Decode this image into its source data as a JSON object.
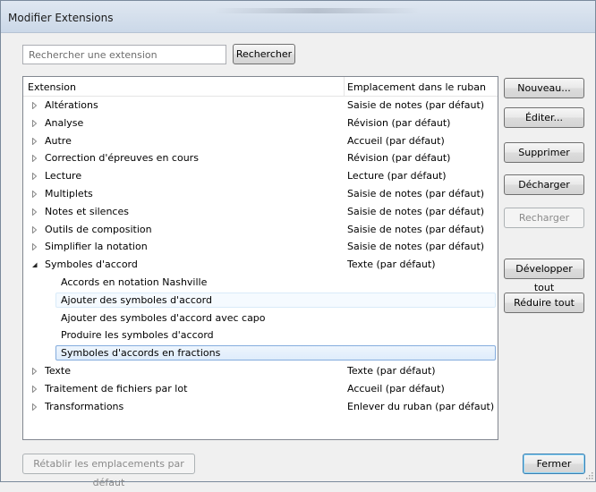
{
  "window": {
    "title": "Modifier Extensions"
  },
  "search": {
    "placeholder": "Rechercher une extension",
    "button_label": "Rechercher"
  },
  "list": {
    "columns": [
      "Extension",
      "Emplacement dans le ruban"
    ],
    "rows": [
      {
        "name": "Altérations",
        "location": "Saisie de notes (par défaut)",
        "expanded": false
      },
      {
        "name": "Analyse",
        "location": "Révision (par défaut)",
        "expanded": false
      },
      {
        "name": "Autre",
        "location": "Accueil (par défaut)",
        "expanded": false
      },
      {
        "name": "Correction d'épreuves en cours",
        "location": "Révision (par défaut)",
        "expanded": false
      },
      {
        "name": "Lecture",
        "location": "Lecture (par défaut)",
        "expanded": false
      },
      {
        "name": "Multiplets",
        "location": "Saisie de notes (par défaut)",
        "expanded": false
      },
      {
        "name": "Notes et silences",
        "location": "Saisie de notes (par défaut)",
        "expanded": false
      },
      {
        "name": "Outils de composition",
        "location": "Saisie de notes (par défaut)",
        "expanded": false
      },
      {
        "name": "Simplifier la notation",
        "location": "Saisie de notes (par défaut)",
        "expanded": false
      },
      {
        "name": "Symboles d'accord",
        "location": "Texte (par défaut)",
        "expanded": true,
        "children": [
          {
            "name": "Accords en notation Nashville",
            "state": "normal"
          },
          {
            "name": "Ajouter des symboles d'accord",
            "state": "hover"
          },
          {
            "name": "Ajouter des symboles d'accord avec capo",
            "state": "normal"
          },
          {
            "name": "Produire les symboles d'accord",
            "state": "normal"
          },
          {
            "name": "Symboles d'accords en fractions",
            "state": "selected"
          }
        ]
      },
      {
        "name": "Texte",
        "location": "Texte (par défaut)",
        "expanded": false
      },
      {
        "name": "Traitement de fichiers par lot",
        "location": "Accueil (par défaut)",
        "expanded": false
      },
      {
        "name": "Transformations",
        "location": "Enlever du ruban (par défaut)",
        "expanded": false
      }
    ]
  },
  "buttons": {
    "new": "Nouveau...",
    "edit": "Éditer...",
    "delete": "Supprimer",
    "unload": "Décharger",
    "reload": "Recharger",
    "expand_all": "Développer tout",
    "collapse_all": "Réduire tout",
    "reset": "Rétablir les emplacements par défaut",
    "close": "Fermer"
  },
  "icons": {
    "collapsed": "triangle-right-icon",
    "expanded": "triangle-down-icon"
  },
  "colors": {
    "selection_border": "#84acdd",
    "hover_border": "#d9ebf9",
    "focus_accent": "#3c7fb1"
  }
}
